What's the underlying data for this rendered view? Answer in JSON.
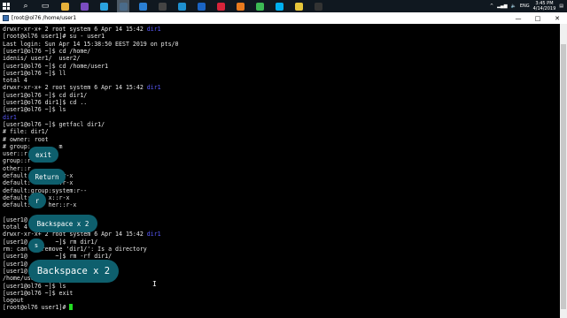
{
  "taskbar": {
    "icons": [
      {
        "name": "search-icon",
        "glyph": "⌕",
        "color": "#ffffff"
      },
      {
        "name": "task-view-icon",
        "glyph": "▭",
        "color": "#ffffff"
      },
      {
        "name": "folder-icon",
        "glyph": "",
        "color": "#e8b23a"
      },
      {
        "name": "vs-icon",
        "glyph": "",
        "color": "#7a4cc0"
      },
      {
        "name": "telegram-icon",
        "glyph": "",
        "color": "#2aa3e0"
      },
      {
        "name": "putty-icon",
        "glyph": "",
        "color": "#4a6b8a"
      },
      {
        "name": "mail-icon",
        "glyph": "",
        "color": "#2a7fd4"
      },
      {
        "name": "app-icon",
        "glyph": "",
        "color": "#444444"
      },
      {
        "name": "store-icon",
        "glyph": "",
        "color": "#1e90d0"
      },
      {
        "name": "hp-icon",
        "glyph": "",
        "color": "#1a64c4"
      },
      {
        "name": "opera-icon",
        "glyph": "",
        "color": "#d6243a"
      },
      {
        "name": "firefox-icon",
        "glyph": "",
        "color": "#e87a1e"
      },
      {
        "name": "chrome-icon",
        "glyph": "",
        "color": "#3cba54"
      },
      {
        "name": "skype-icon",
        "glyph": "",
        "color": "#00aff0"
      },
      {
        "name": "notes-icon",
        "glyph": "",
        "color": "#e6c53a"
      },
      {
        "name": "video-icon",
        "glyph": "",
        "color": "#333333"
      }
    ],
    "tray": {
      "lang": "ENG",
      "time": "3:45 PM",
      "date": "4/14/2019"
    }
  },
  "window": {
    "title": "[root@ol76 /home/user1",
    "buttons": {
      "minimize": "—",
      "maximize": "□",
      "close": "✕"
    }
  },
  "terminal": {
    "lines": [
      {
        "text": "drwxr-xr-x+ 2 root system 6 Apr 14 15:42 ",
        "dir": "dir1"
      },
      {
        "text": "[root@ol76 user1]# su - user1"
      },
      {
        "text": "Last login: Sun Apr 14 15:38:50 EEST 2019 on pts/0"
      },
      {
        "text": "[user1@ol76 ~]$ cd /home/"
      },
      {
        "text": "idenis/ user1/  user2/"
      },
      {
        "text": "[user1@ol76 ~]$ cd /home/user1"
      },
      {
        "text": "[user1@ol76 ~]$ ll"
      },
      {
        "text": "total 4"
      },
      {
        "text": "drwxr-xr-x+ 2 root system 6 Apr 14 15:42 ",
        "dir": "dir1"
      },
      {
        "text": "[user1@ol76 ~]$ cd dir1/"
      },
      {
        "text": "[user1@ol76 dir1]$ cd .."
      },
      {
        "text": "[user1@ol76 ~]$ ls"
      },
      {
        "text": "",
        "dir": "dir1"
      },
      {
        "text": "[user1@ol76 ~]$ getfacl dir1/"
      },
      {
        "text": "# file: dir1/"
      },
      {
        "text": "# owner: root"
      },
      {
        "text": "# group:        m"
      },
      {
        "text": "user::r"
      },
      {
        "text": "group::r"
      },
      {
        "text": "other::r"
      },
      {
        "text": "default:        :r-x"
      },
      {
        "text": "default:        :r-x"
      },
      {
        "text": "default:group:system:r--"
      },
      {
        "text": "default:     x::r-x"
      },
      {
        "text": "default:     her::r-x"
      },
      {
        "text": ""
      },
      {
        "text": "[user1@"
      },
      {
        "text": "total 4"
      },
      {
        "text": "drwxr-xr-x+ 2 root system 6 Apr 14 15:42 ",
        "dir": "dir1"
      },
      {
        "text": "[user1@        ~]$ rm dir1/"
      },
      {
        "text": "rm: can    remove 'dir1/': Is a directory"
      },
      {
        "text": "[user1@        ~]$ rm -rf dir1/"
      },
      {
        "text": "[user1@"
      },
      {
        "text": "[user1@"
      },
      {
        "text": "/home/user"
      },
      {
        "text": "[user1@ol76 ~]$ ls"
      },
      {
        "text": "[user1@ol76 ~]$ exit"
      },
      {
        "text": "logout"
      },
      {
        "text": "[root@ol76 user1]# ",
        "cursor": true
      }
    ]
  },
  "overlays": [
    {
      "label": "exit",
      "size": "small"
    },
    {
      "label": "Return",
      "size": "small"
    },
    {
      "label": "r",
      "size": "small"
    },
    {
      "label": "Backspace x 2",
      "size": "small"
    },
    {
      "label": "s",
      "size": "small"
    },
    {
      "label": "Backspace x 2",
      "size": "large"
    }
  ]
}
